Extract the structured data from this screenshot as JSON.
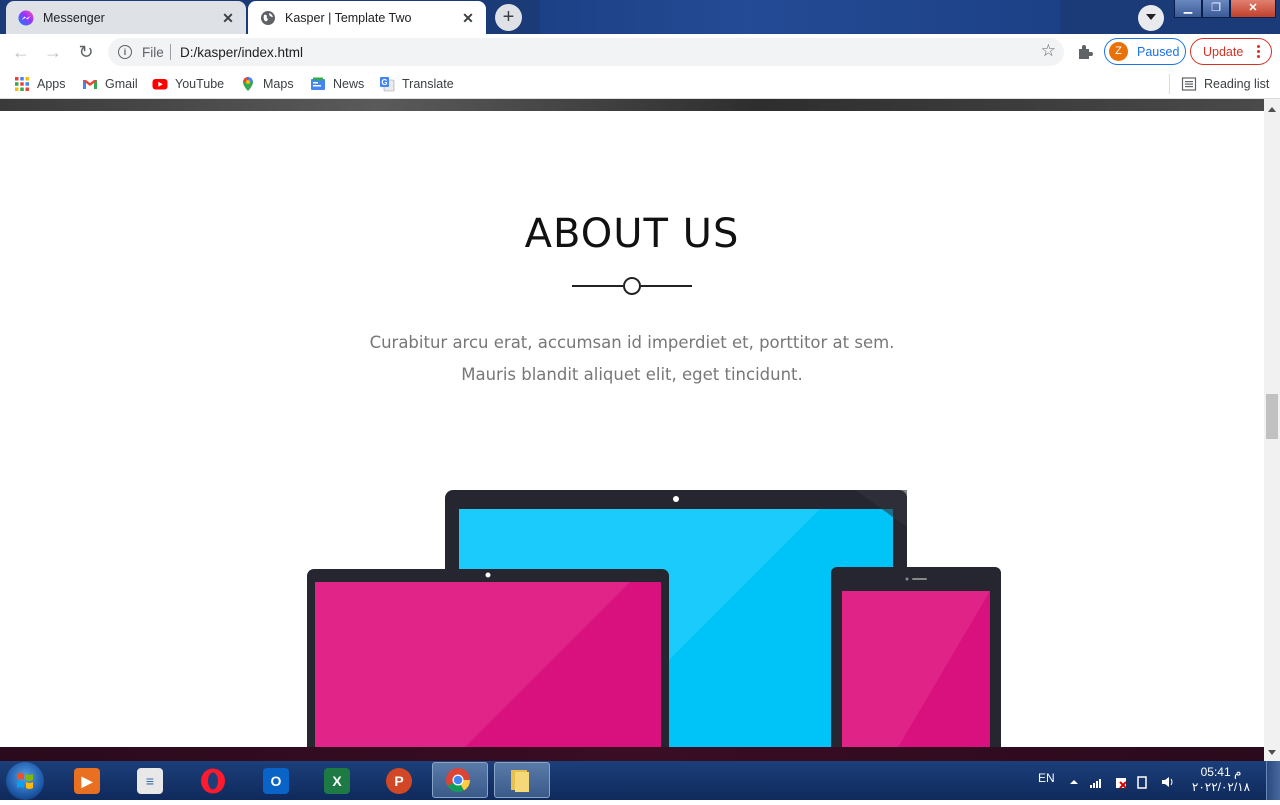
{
  "browser": {
    "tabs": [
      {
        "title": "Messenger",
        "active": false,
        "icon": "messenger-icon"
      },
      {
        "title": "Kasper | Template Two",
        "active": true,
        "icon": "globe-icon"
      }
    ],
    "address": {
      "scheme_label": "File",
      "url": "D:/kasper/index.html"
    },
    "profile": {
      "initial": "Z",
      "status": "Paused"
    },
    "update_label": "Update",
    "bookmarks": [
      {
        "label": "Apps",
        "icon": "apps-grid-icon"
      },
      {
        "label": "Gmail",
        "icon": "gmail-icon"
      },
      {
        "label": "YouTube",
        "icon": "youtube-icon"
      },
      {
        "label": "Maps",
        "icon": "maps-pin-icon"
      },
      {
        "label": "News",
        "icon": "news-icon"
      },
      {
        "label": "Translate",
        "icon": "translate-icon"
      }
    ],
    "reading_list": "Reading list"
  },
  "page": {
    "section_title": "ABOUT US",
    "description": "Curabitur arcu erat, accumsan id imperdiet et, porttitor at sem. Mauris blandit aliquet elit, eget tincidunt."
  },
  "colors": {
    "screen_cyan": "#00c3f7",
    "screen_magenta": "#d9117e",
    "device_frame": "#262631",
    "taskbar": "#163670"
  },
  "taskbar": {
    "apps": [
      "media-player-icon",
      "document-viewer-icon",
      "opera-icon",
      "outlook-icon",
      "excel-icon",
      "powerpoint-icon",
      "chrome-icon",
      "folder-icon"
    ],
    "language": "EN",
    "time": "05:41 م",
    "date": "٢٠٢٢/٠٢/١٨"
  }
}
